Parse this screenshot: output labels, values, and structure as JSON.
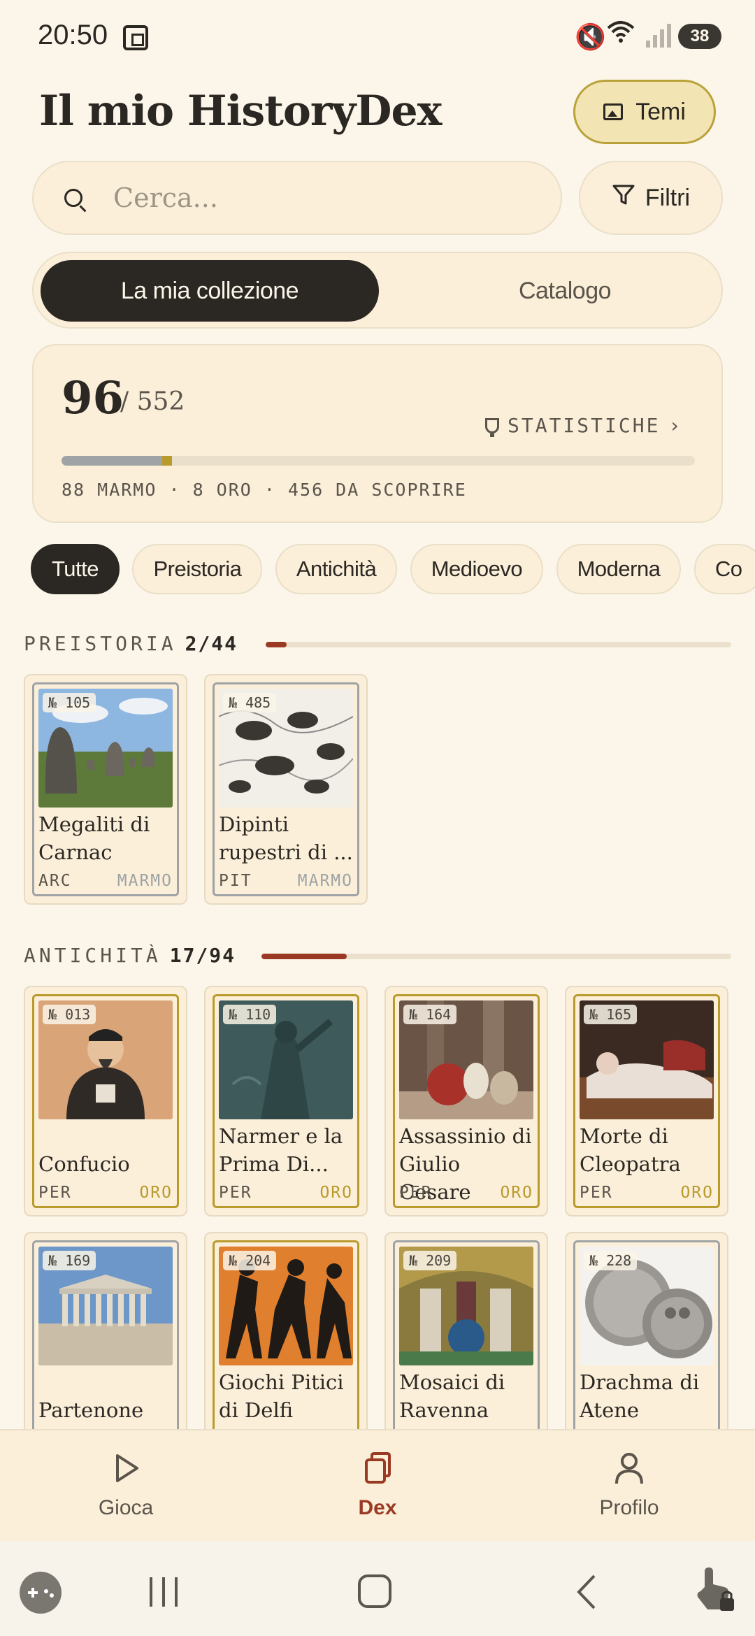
{
  "status": {
    "time": "20:50",
    "battery": "38"
  },
  "header": {
    "title": "Il mio HistoryDex",
    "temi_label": "Temi"
  },
  "search": {
    "placeholder": "Cerca...",
    "value": ""
  },
  "filter_label": "Filtri",
  "segments": {
    "active": "La mia collezione",
    "inactive": "Catalogo"
  },
  "stats": {
    "count": "96",
    "total": "/ 552",
    "stat_label": "STATISTICHE",
    "legend": "88 MARMO · 8 ORO · 456 DA SCOPRIRE",
    "marmo_fraction": 0.1594,
    "oro_fraction": 0.0145
  },
  "chips": [
    "Tutte",
    "Preistoria",
    "Antichità",
    "Medioevo",
    "Moderna",
    "Co"
  ],
  "sections": [
    {
      "title": "PREISTORIA",
      "count": "2/44",
      "fraction": 0.045,
      "cards": [
        {
          "num": "№ 105",
          "name": "Megaliti di Carnac",
          "cat": "ARC",
          "rarity": "MARMO"
        },
        {
          "num": "№ 485",
          "name": "Dipinti rupestri di ...",
          "cat": "PIT",
          "rarity": "MARMO"
        }
      ]
    },
    {
      "title": "ANTICHITÀ",
      "count": "17/94",
      "fraction": 0.181,
      "cards": [
        {
          "num": "№ 013",
          "name": "Confucio",
          "cat": "PER",
          "rarity": "ORO"
        },
        {
          "num": "№ 110",
          "name": "Narmer e la Prima Di...",
          "cat": "PER",
          "rarity": "ORO"
        },
        {
          "num": "№ 164",
          "name": "Assassinio di Giulio Cesare",
          "cat": "PER",
          "rarity": "ORO"
        },
        {
          "num": "№ 165",
          "name": "Morte di Cleopatra",
          "cat": "PER",
          "rarity": "ORO"
        },
        {
          "num": "№ 169",
          "name": "Partenone"
        },
        {
          "num": "№ 204",
          "name": "Giochi Pitici di Delfi"
        },
        {
          "num": "№ 209",
          "name": "Mosaici di Ravenna"
        },
        {
          "num": "№ 228",
          "name": "Drachma di Atene"
        }
      ]
    }
  ],
  "nav": {
    "play": "Gioca",
    "dex": "Dex",
    "profile": "Profilo"
  },
  "colors": {
    "accent": "#9b3a24",
    "gold": "#b99a2c",
    "marble": "#9fa3a6",
    "background": "#fcf6ea"
  }
}
